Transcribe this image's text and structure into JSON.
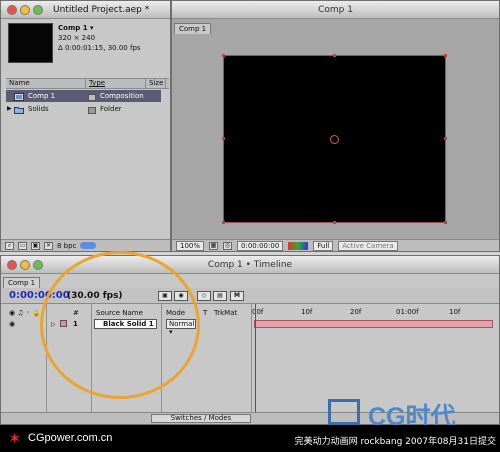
{
  "project": {
    "title": "Untitled Project.aep *",
    "comp_name": "Comp 1 ▾",
    "comp_size": "320 × 240",
    "comp_duration": "Δ 0:00:01:15, 30.00 fps",
    "columns": [
      "Name",
      "Type",
      "Size"
    ],
    "items": [
      {
        "name": "Comp 1",
        "type": "Composition",
        "icon": "composition-icon",
        "color": "#5b5b75"
      },
      {
        "name": "Solids",
        "type": "Folder",
        "icon": "folder-icon",
        "color": "#c8c8c8"
      }
    ],
    "footer_bpc": "8 bpc"
  },
  "comp": {
    "title": "Comp 1",
    "tab": "Comp 1",
    "zoom": "100%",
    "timecode": "0:00:00:00",
    "resolution": "Full",
    "camera": "Active Camera"
  },
  "timeline": {
    "title": "Comp 1 • Timeline",
    "tab": "Comp 1",
    "timecode": "0:00:00:00",
    "fps": "(30.00 fps)",
    "columns": {
      "num": "#",
      "source": "Source Name",
      "mode": "Mode",
      "t": "T",
      "trkmat": "TrkMat"
    },
    "ruler": [
      "00f",
      "10f",
      "20f",
      "01:00f",
      "10f"
    ],
    "layer": {
      "num": "1",
      "name": "Black Solid 1",
      "mode": "Normal ▾"
    },
    "footer": "Switches / Modes"
  },
  "banner": {
    "brand": "CGpower.com.cn",
    "credit": "完美动力动画网 rockbang 2007年08月31日提交",
    "logo": "CG时代"
  },
  "colors": {
    "layer_bar": "#e8a0a8",
    "playhead": "#d42020",
    "highlight_circle": "#eba42d",
    "timecode": "#1d2bb5"
  }
}
